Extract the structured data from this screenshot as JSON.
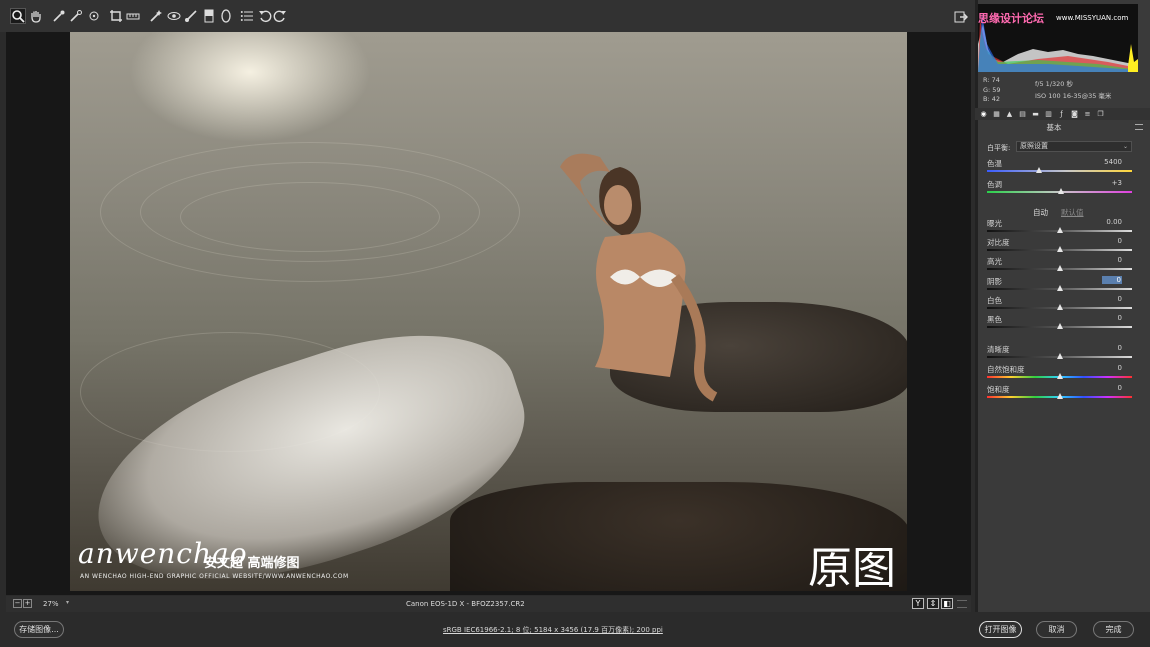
{
  "toolbar": {
    "tools": [
      "zoom-icon",
      "hand-icon",
      "white-balance-icon",
      "color-sampler-icon",
      "target-adjust-icon",
      "crop-icon",
      "straighten-icon",
      "spot-removal-icon",
      "red-eye-icon",
      "adjustment-brush-icon",
      "graduated-filter-icon",
      "radial-filter-icon",
      "presets-list-icon",
      "rotate-ccw-icon",
      "rotate-cw-icon"
    ]
  },
  "photo": {
    "watermark_brand": "anwenchao",
    "watermark_cn": "安文超 高端修图",
    "watermark_sub": "AN WENCHAO HIGH-END GRAPHIC OFFICIAL WEBSITE/WWW.ANWENCHAO.COM",
    "caption": "原图"
  },
  "statusbar": {
    "zoom": "27%",
    "filename": "Canon EOS-1D X -  BFOZ2357.CR2",
    "view_buttons": [
      "Y",
      "⇕",
      "◧"
    ]
  },
  "bottombar": {
    "save": "存储图像...",
    "info": "sRGB IEC61966-2.1; 8 位; 5184 x 3456 (17.9 百万像素); 200 ppi",
    "open": "打开图像",
    "cancel": "取消",
    "done": "完成"
  },
  "histogram": {
    "site_watermark": "思缘设计论坛",
    "site_url": "www.MISSYUAN.com"
  },
  "readout": {
    "r": "R:  74",
    "g": "G:  59",
    "b": "B:  42",
    "aperture": "f/5   1/320 秒",
    "iso": "ISO 100   16-35@35 毫米"
  },
  "panel": {
    "title": "基本",
    "wb_label": "白平衡:",
    "wb_value": "原照设置",
    "auto": "自动",
    "default": "默认值",
    "sliders": [
      {
        "label": "色温",
        "value": "5400",
        "pos": 0.36,
        "track": "temp"
      },
      {
        "label": "色调",
        "value": "+3",
        "pos": 0.51,
        "track": "tint"
      },
      {
        "label": "曝光",
        "value": "0.00",
        "pos": 0.5,
        "track": "gray"
      },
      {
        "label": "对比度",
        "value": "0",
        "pos": 0.5,
        "track": "gray"
      },
      {
        "label": "高光",
        "value": "0",
        "pos": 0.5,
        "track": "gray"
      },
      {
        "label": "阴影",
        "value": "0",
        "pos": 0.5,
        "track": "gray",
        "editing": true
      },
      {
        "label": "白色",
        "value": "0",
        "pos": 0.5,
        "track": "gray"
      },
      {
        "label": "黑色",
        "value": "0",
        "pos": 0.5,
        "track": "gray"
      },
      {
        "label": "清晰度",
        "value": "0",
        "pos": 0.5,
        "track": "gray"
      },
      {
        "label": "自然饱和度",
        "value": "0",
        "pos": 0.5,
        "track": "spectrum"
      },
      {
        "label": "饱和度",
        "value": "0",
        "pos": 0.5,
        "track": "spectrum"
      }
    ]
  },
  "colors": {
    "accent": "#5a7fae"
  }
}
